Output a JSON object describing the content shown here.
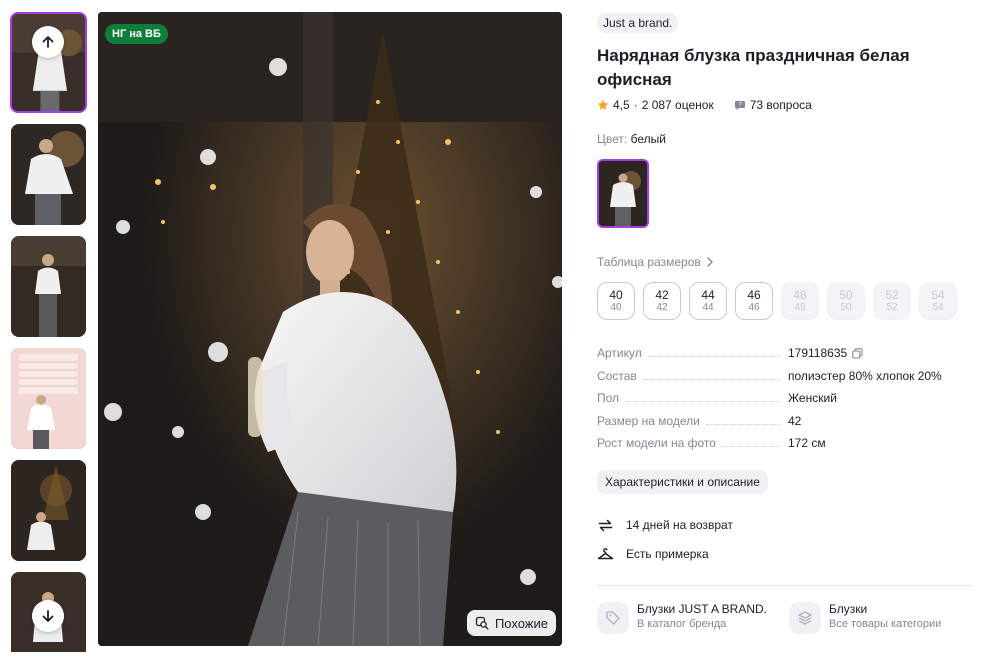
{
  "badge": "НГ на ВБ",
  "similar_label": "Похожие",
  "brand": "Just a brand.",
  "title": "Нарядная блузка праздничная белая офисная",
  "rating": {
    "value": "4,5",
    "reviews": "2 087 оценок",
    "questions": "73 вопроса"
  },
  "color": {
    "label": "Цвет:",
    "value": "белый"
  },
  "size_table_label": "Таблица размеров",
  "sizes": [
    {
      "ru": "40",
      "eu": "40",
      "available": true
    },
    {
      "ru": "42",
      "eu": "42",
      "available": true
    },
    {
      "ru": "44",
      "eu": "44",
      "available": true
    },
    {
      "ru": "46",
      "eu": "46",
      "available": true
    },
    {
      "ru": "48",
      "eu": "48",
      "available": false
    },
    {
      "ru": "50",
      "eu": "50",
      "available": false
    },
    {
      "ru": "52",
      "eu": "52",
      "available": false
    },
    {
      "ru": "54",
      "eu": "54",
      "available": false
    }
  ],
  "specs": [
    {
      "k": "Артикул",
      "v": "179118635"
    },
    {
      "k": "Состав",
      "v": "полиэстер 80% хлопок 20%"
    },
    {
      "k": "Пол",
      "v": "Женский"
    },
    {
      "k": "Размер на модели",
      "v": "42"
    },
    {
      "k": "Рост модели на фото",
      "v": "172 см"
    }
  ],
  "chars_button": "Характеристики и описание",
  "features": [
    {
      "icon": "return-arrows-icon",
      "text": "14 дней на возврат"
    },
    {
      "icon": "hanger-icon",
      "text": "Есть примерка"
    }
  ],
  "links": [
    {
      "icon": "tag-icon",
      "title": "Блузки JUST A BRAND.",
      "sub": "В каталог бренда"
    },
    {
      "icon": "layers-icon",
      "title": "Блузки",
      "sub": "Все товары категории"
    }
  ],
  "colors": {
    "accent": "#a83be6",
    "badge": "#0d7d3a",
    "star": "#ff9f1c",
    "muted": "#868695"
  }
}
